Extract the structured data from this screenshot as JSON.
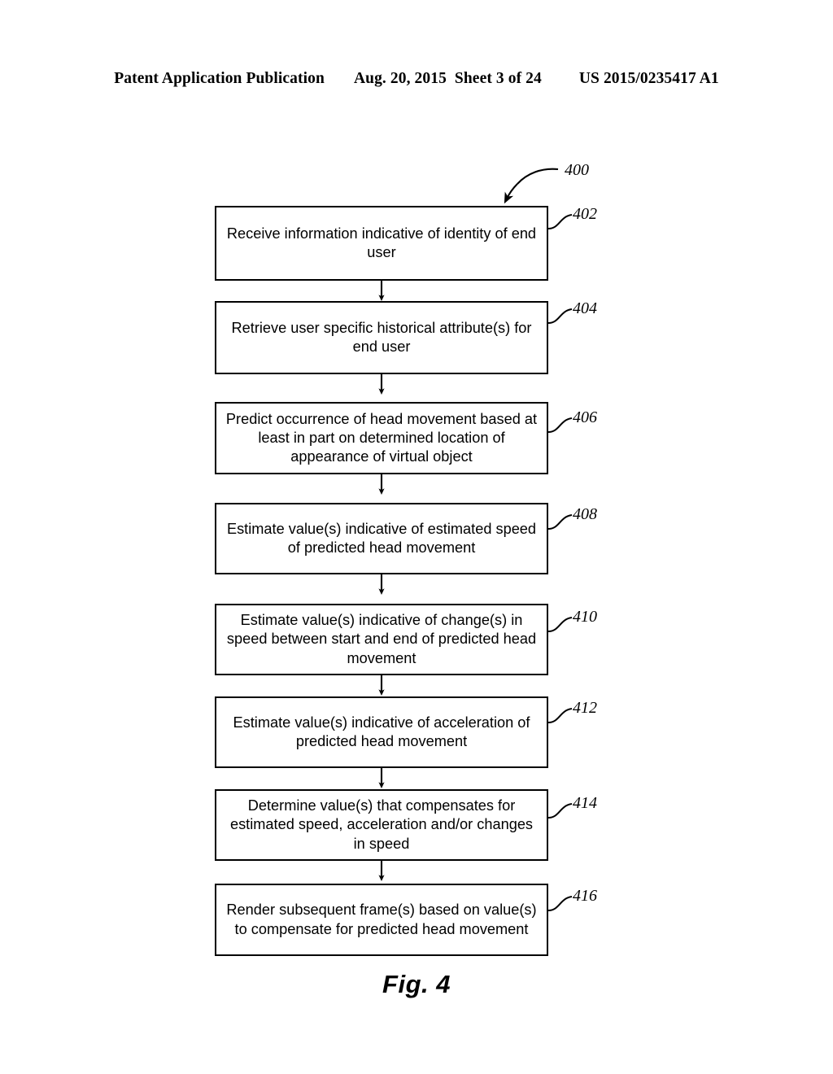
{
  "header": {
    "publication": "Patent Application Publication",
    "date": "Aug. 20, 2015",
    "sheet": "Sheet 3 of 24",
    "patent_number": "US 2015/0235417 A1"
  },
  "figure": {
    "caption": "Fig. 4",
    "diagram_reference": "400",
    "line_color": "#000000",
    "background_color": "#ffffff"
  },
  "flowchart": {
    "steps": [
      {
        "ref": "402",
        "text": "Receive information indicative of identity of end user"
      },
      {
        "ref": "404",
        "text": "Retrieve user specific historical attribute(s) for end user"
      },
      {
        "ref": "406",
        "text": "Predict occurrence of head movement based at least in part on determined location of appearance of virtual object"
      },
      {
        "ref": "408",
        "text": "Estimate value(s) indicative of estimated speed of predicted head movement"
      },
      {
        "ref": "410",
        "text": "Estimate value(s) indicative of change(s) in speed between start and end of predicted head movement"
      },
      {
        "ref": "412",
        "text": "Estimate value(s) indicative of acceleration of predicted head movement"
      },
      {
        "ref": "414",
        "text": "Determine value(s) that compensates for estimated speed, acceleration and/or changes in speed"
      },
      {
        "ref": "416",
        "text": "Render subsequent frame(s) based on value(s) to compensate for predicted head movement"
      }
    ]
  }
}
